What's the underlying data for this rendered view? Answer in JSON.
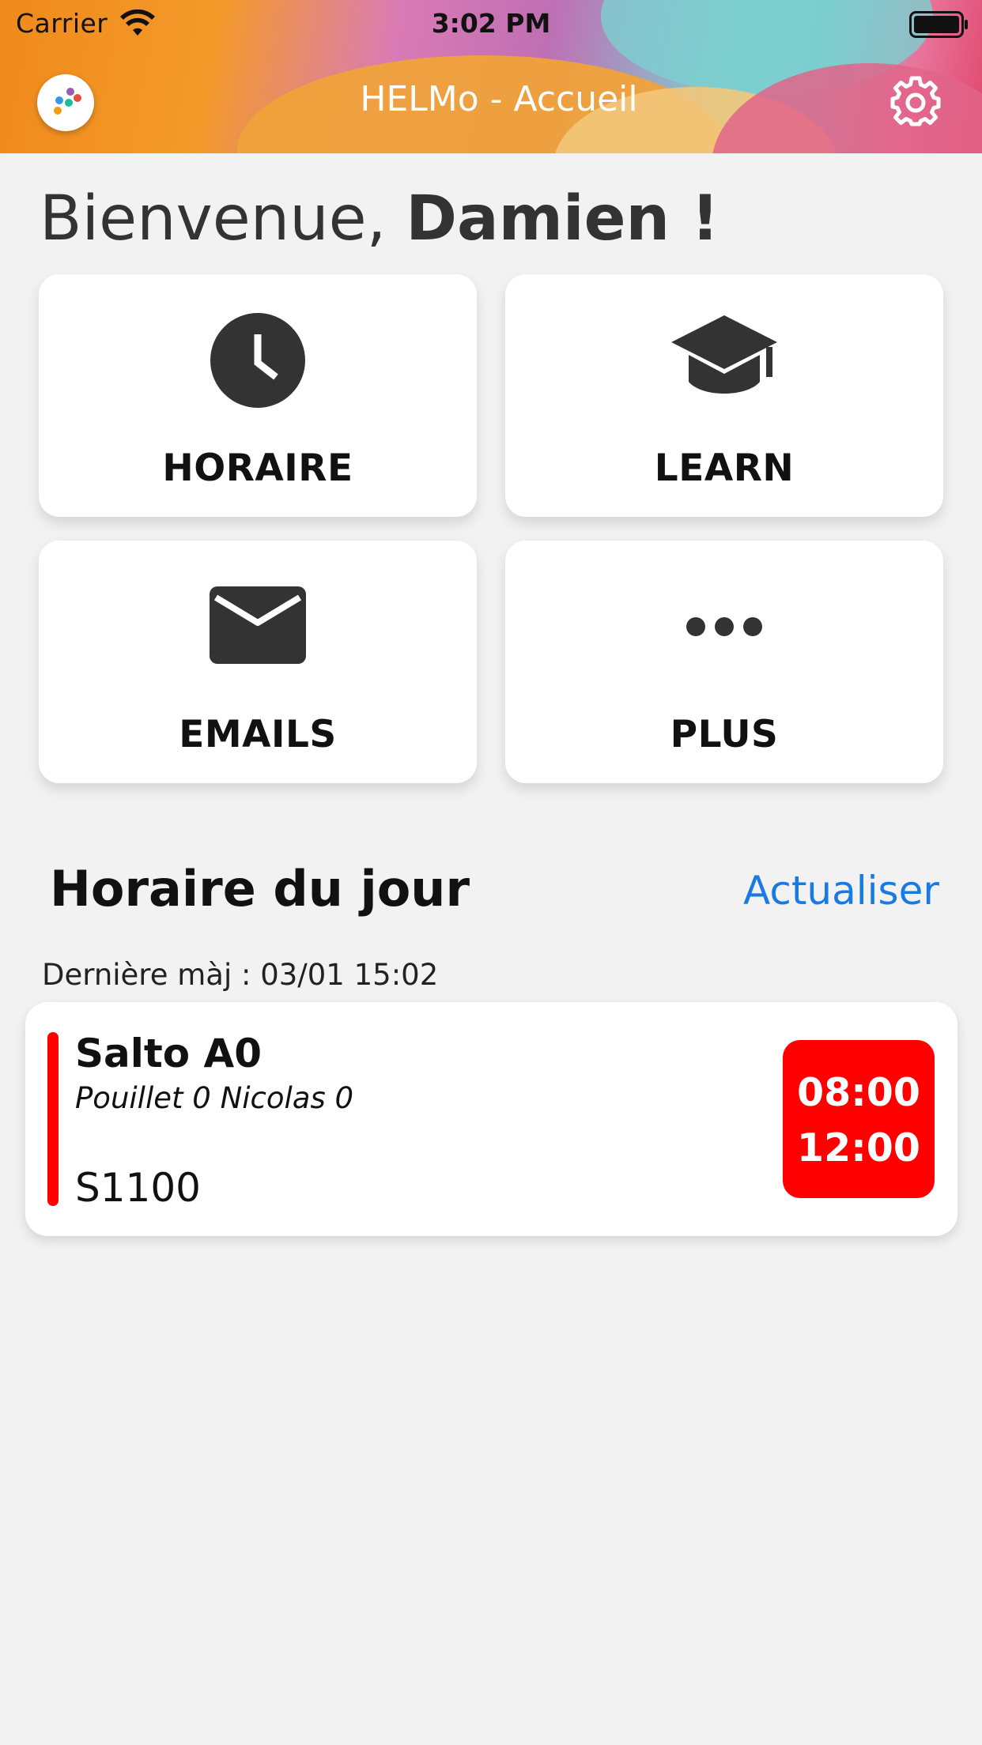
{
  "status_bar": {
    "carrier": "Carrier",
    "time": "3:02 PM"
  },
  "header": {
    "title": "HELMo -  Accueil",
    "logo_icon": "helmo-dots-logo-icon",
    "settings_icon": "gear-icon"
  },
  "welcome": {
    "greeting": "Bienvenue, ",
    "name": "Damien !"
  },
  "tiles": [
    {
      "label": "HORAIRE",
      "icon": "clock-icon"
    },
    {
      "label": "LEARN",
      "icon": "graduation-cap-icon"
    },
    {
      "label": "EMAILS",
      "icon": "envelope-icon"
    },
    {
      "label": "PLUS",
      "icon": "more-dots-icon"
    }
  ],
  "schedule": {
    "title": "Horaire du jour",
    "refresh_label": "Actualiser",
    "last_update": "Dernière màj : 03/01 15:02",
    "courses": [
      {
        "name": "Salto A0",
        "teacher": "Pouillet 0 Nicolas 0",
        "room": "S1100",
        "start": "08:00",
        "end": "12:00",
        "color": "#ff0000"
      }
    ]
  },
  "colors": {
    "accent_link": "#1a7ae3",
    "course_red": "#ff0000",
    "background": "#f2f2f2",
    "icon_dark": "#333333"
  }
}
